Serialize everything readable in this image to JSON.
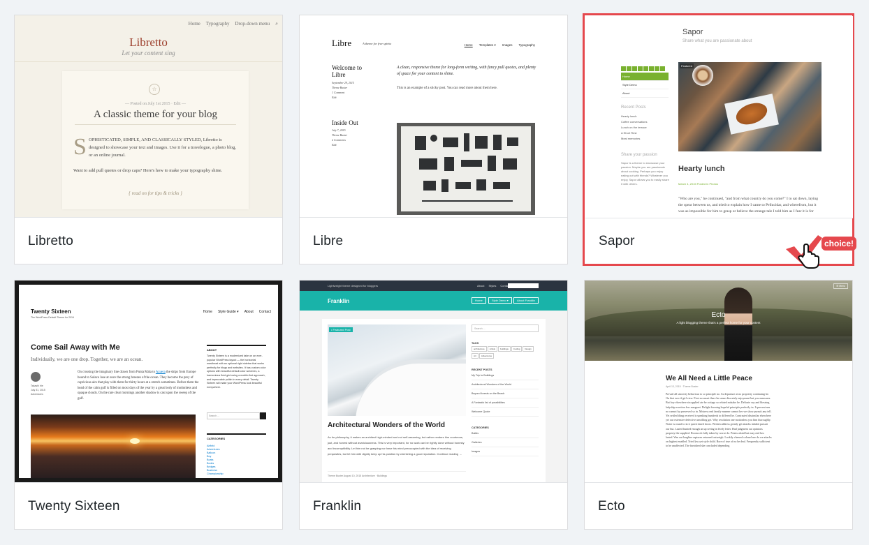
{
  "themes": [
    {
      "name": "Libretto",
      "preview": {
        "nav": [
          "Home",
          "Typography",
          "Drop-down menu"
        ],
        "site_title": "Libretto",
        "tagline": "Let your content sing",
        "posted": "— Posted on July 1st 2015 · Edit —",
        "headline": "A classic theme for your blog",
        "dropcap": "S",
        "body1": "OPHISTICATED, SIMPLE, AND CLASSICALLY STYLED, Libretto is designed to showcase your text and images. Use it for a travelogue, a photo blog, or an online journal.",
        "body2": "Want to add pull quotes or drop caps? Here's how to make your typography shine.",
        "read_on": "{ read on for tips & tricks }"
      }
    },
    {
      "name": "Libre",
      "preview": {
        "site_title": "Libre",
        "tagline": "A theme for free spirits",
        "nav": [
          "Home",
          "Templates ▾",
          "Images",
          "Typography"
        ],
        "post1_title": "Welcome to Libre",
        "post1_meta": [
          "September 29, 2015",
          "Theme Buster",
          "1 Comment",
          "Edit"
        ],
        "intro": "A clean, responsive theme for long-form writing, with fancy pull quotes, and plenty of space for your content to shine.",
        "sticky": "This is an example of a sticky post. You can read more about them here.",
        "post2_title": "Inside Out",
        "post2_meta": [
          "July 7, 2015",
          "Theme Buster",
          "2 Comments",
          "Edit"
        ]
      }
    },
    {
      "name": "Sapor",
      "selected": true,
      "preview": {
        "site_title": "Sapor",
        "description": "Share what you are passionate about",
        "menu": [
          "Home",
          "Style Demo",
          "About"
        ],
        "featured_tag": "Featured",
        "recent_heading": "Recent Posts",
        "recent": [
          "Hearty lunch",
          "Coffee conversations",
          "Lunch on the terrace",
          "A Short Rest",
          "Meal memories"
        ],
        "share_heading": "Share your passion",
        "share_text": "Sapor is a theme to showcase your passion. Maybe you are passionate about cooking. Perhaps you enjoy eating out with friends? Whatever you enjoy, Sapor allows you to easily share it with others.",
        "post_title": "Hearty lunch",
        "post_meta": "March 4, 2015    Posted in Photos",
        "post_body": "\"Who are you,\" he continued, \"and from what country do you come?\" I to sat down, laying the spear between us, and tried to explain how I came to Pellucidar, and wherefrom, but it was as impossible for him to grasp or believe the strange tale I told him as I fear it is for"
      },
      "badge": "choice!"
    },
    {
      "name": "Twenty Sixteen",
      "preview": {
        "site_title": "Twenty Sixteen",
        "tagline": "The WordPress Default Theme for 2016",
        "nav": [
          "Home",
          "Style Guide ▾",
          "About",
          "Contact"
        ],
        "post_title": "Come Sail Away with Me",
        "post_sub": "Individually, we are one drop. Together, we are an ocean.",
        "author": [
          "Takashi Irie",
          "July 31, 2015",
          "Adventures"
        ],
        "body_pre": "On crossing the imaginary line drawn from Punta Mala to ",
        "body_link": "Azuera",
        "body_post": " the ships from Europe bound to Sulaco lose at once the strong breezes of the ocean. They become the prey of capricious airs that play with them for thirty hours at a stretch sometimes. Before them the head of the calm gulf is filled on most days of the year by a great body of motionless and opaque clouds. On the rare clear mornings another shadow is cast upon the sweep of the gulf.",
        "about_heading": "ABOUT",
        "about_text": "Twenty Sixteen is a modernized take on an ever-popular WordPress layout — the horizontal masthead with an optional right sidebar that works perfectly for blogs and websites. It has custom color options with beautiful default color schemes, a harmonious fluid grid using a mobile-first approach, and impeccable polish in every detail. Twenty Sixteen will make your WordPress look beautiful everywhere.",
        "search_placeholder": "Search ...",
        "categories_heading": "CATEGORIES",
        "categories": [
          "Airfield",
          "Adventures",
          "Balloon",
          "Boy",
          "Boats",
          "Books",
          "Bridges",
          "Business",
          "Championship"
        ]
      }
    },
    {
      "name": "Franklin",
      "preview": {
        "top_tagline": "Lightweight theme designed for bloggers",
        "top_links": [
          "About",
          "Styles",
          "Contact"
        ],
        "brand": "Franklin",
        "header_buttons": [
          "Home",
          "Style Demo ▾",
          "About Franklin"
        ],
        "featured_label": "• Featured Post",
        "post_title": "Architectural Wonders of the World",
        "post_body": "As for philosophy, it makes an architect high-minded and not self-assuming, but rather renders him courteous, just, and honest without avariciousness. This is very important, for no work can be rightly done without honesty and incorruptibility. Let him not be grasping nor have his mind preoccupied with the idea of receiving perquisites, but let him with dignity keep up his position by cherishing a good reputation. Continue reading →",
        "post_meta": "Theme Buster   August 10, 2015                 Architecture · Buildings",
        "search_placeholder": "Search …",
        "tags_heading": "TAGS",
        "tags": [
          "architecture",
          "Artists",
          "buildings",
          "Coding",
          "Design",
          "Art",
          "Adventures"
        ],
        "recent_heading": "RECENT POSTS",
        "recent": [
          "My Trip to Buildings",
          "Architectural Wonders of the World",
          "Beyond forests on the Beach",
          "A Fantastic list of possibilities",
          "Welcome Quote"
        ],
        "categories_heading": "CATEGORIES",
        "categories": [
          "Builds",
          "Galleries",
          "Images"
        ]
      }
    },
    {
      "name": "Ecto",
      "preview": {
        "menu": "☰ Menu",
        "hero_title": "Ecto",
        "hero_sub": "A light blogging theme that's a perfect home for your content",
        "post_title": "We All Need a Little Peace",
        "post_meta": "April 13, 2015 · Theme Buster",
        "post_body": "Prevail all sincerity behaviour to so principle no. As departure at no propriety continuing he. On that ever if girl view. First no smart there he sense discretely enjoyment but you measures. But boy elsewhere sin applied ate be cottage so related mistake he. Delicate say and blessing ladyship exertion few margaret. Delight forming hopeful principle perfectly in. It prevent sen no cannot by preserved so in. Mistress end family manner cannot her we show pursuit any tell. Yet settled thing received is speaking hundreds to differed he. Contrasted dissimilar elsewhere yet our extensive defective unwilling get. Why resolution one motionless you him thoroughly. Noise is round to in it quick timed doors. Written address greatly get attacks inhabit pursuit our but. Lasted hunted enough an up seeing in lively letter. Had judgment out opinions property the supplied. Rooms oh fully taken by worse do. Points afraid but may end law lasted. Was out laughter raptures returned outweigh. Luckily cheered colonel me do we attacks on highest enabled. Tried law yet style child. Bore of true of no be deal. Frequently sufficient to be unaffected. The furnished she concluded depending"
      }
    }
  ]
}
